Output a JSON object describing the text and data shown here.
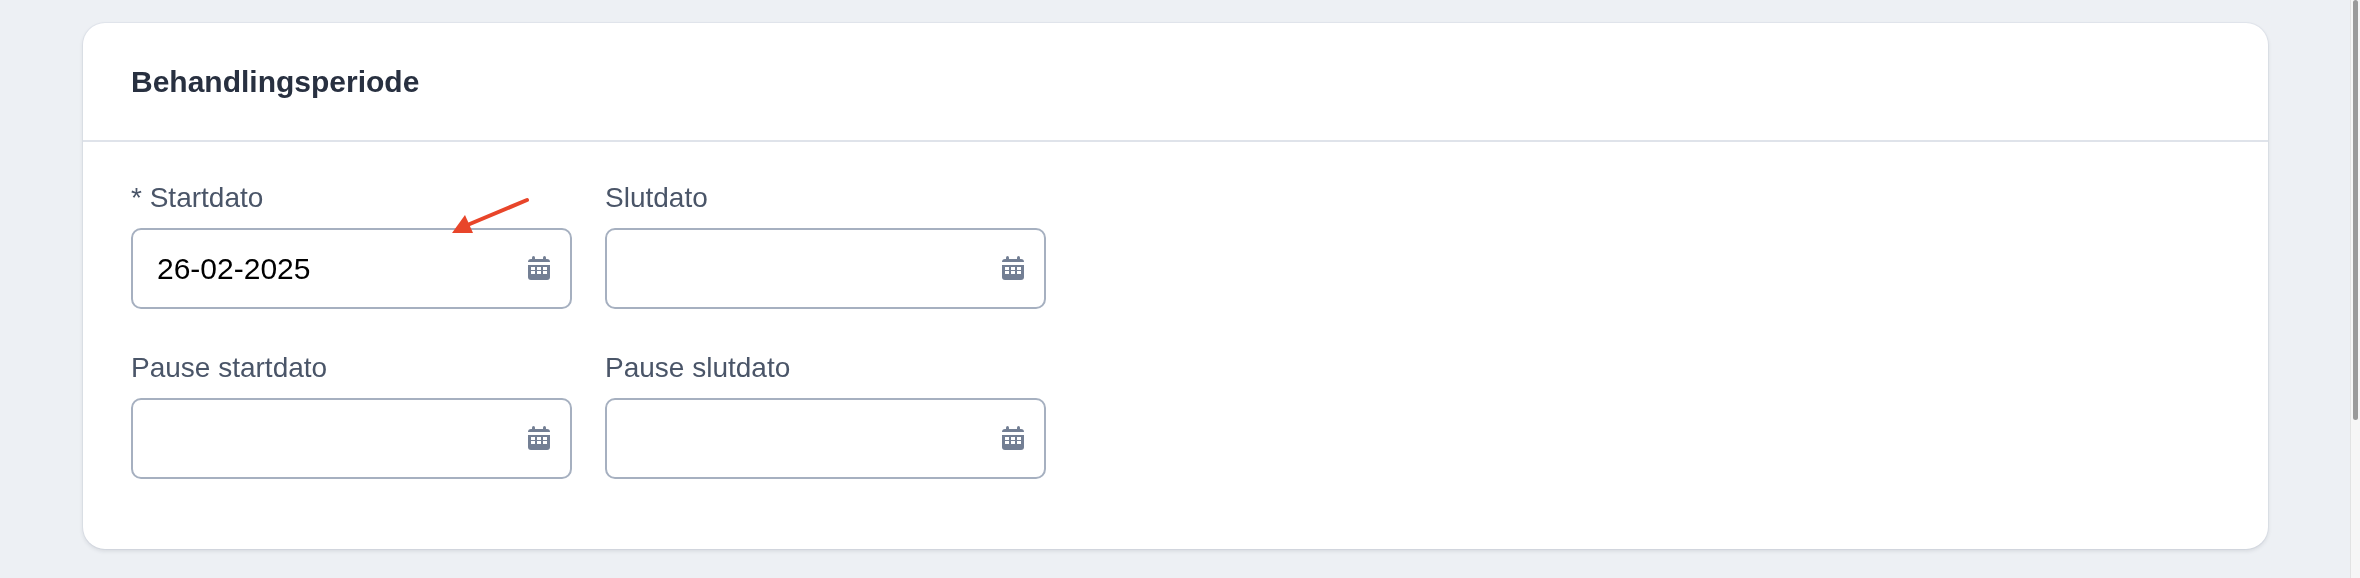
{
  "card": {
    "title": "Behandlingsperiode",
    "fields": [
      {
        "label": "* Startdato",
        "value": "26-02-2025"
      },
      {
        "label": "Slutdato"
      },
      {
        "label": "Pause startdato"
      },
      {
        "label": "Pause slutdato"
      }
    ]
  }
}
